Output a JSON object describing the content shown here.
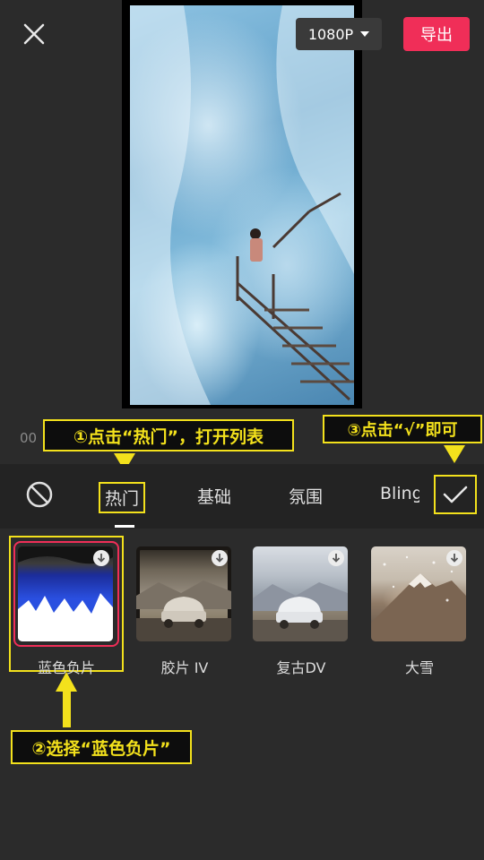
{
  "topbar": {
    "resolution": "1080P",
    "export_label": "导出"
  },
  "player": {
    "timecode_partial": "00"
  },
  "callouts": {
    "step1": "①点击“热门”，打开列表",
    "step2": "②选择“蓝色负片”",
    "step3": "③点击“√”即可",
    "color": "#f3e11c"
  },
  "filter_tabs": {
    "items": [
      {
        "label": "热门"
      },
      {
        "label": "基础"
      },
      {
        "label": "氛围"
      },
      {
        "label": "Bling"
      }
    ],
    "active": "热门"
  },
  "filters": [
    {
      "label": "蓝色负片",
      "selected": true
    },
    {
      "label": "胶片 IV",
      "selected": false
    },
    {
      "label": "复古DV",
      "selected": false
    },
    {
      "label": "大雪",
      "selected": false
    }
  ],
  "colors": {
    "accent": "#f02e58",
    "background": "#2b2b2b"
  }
}
